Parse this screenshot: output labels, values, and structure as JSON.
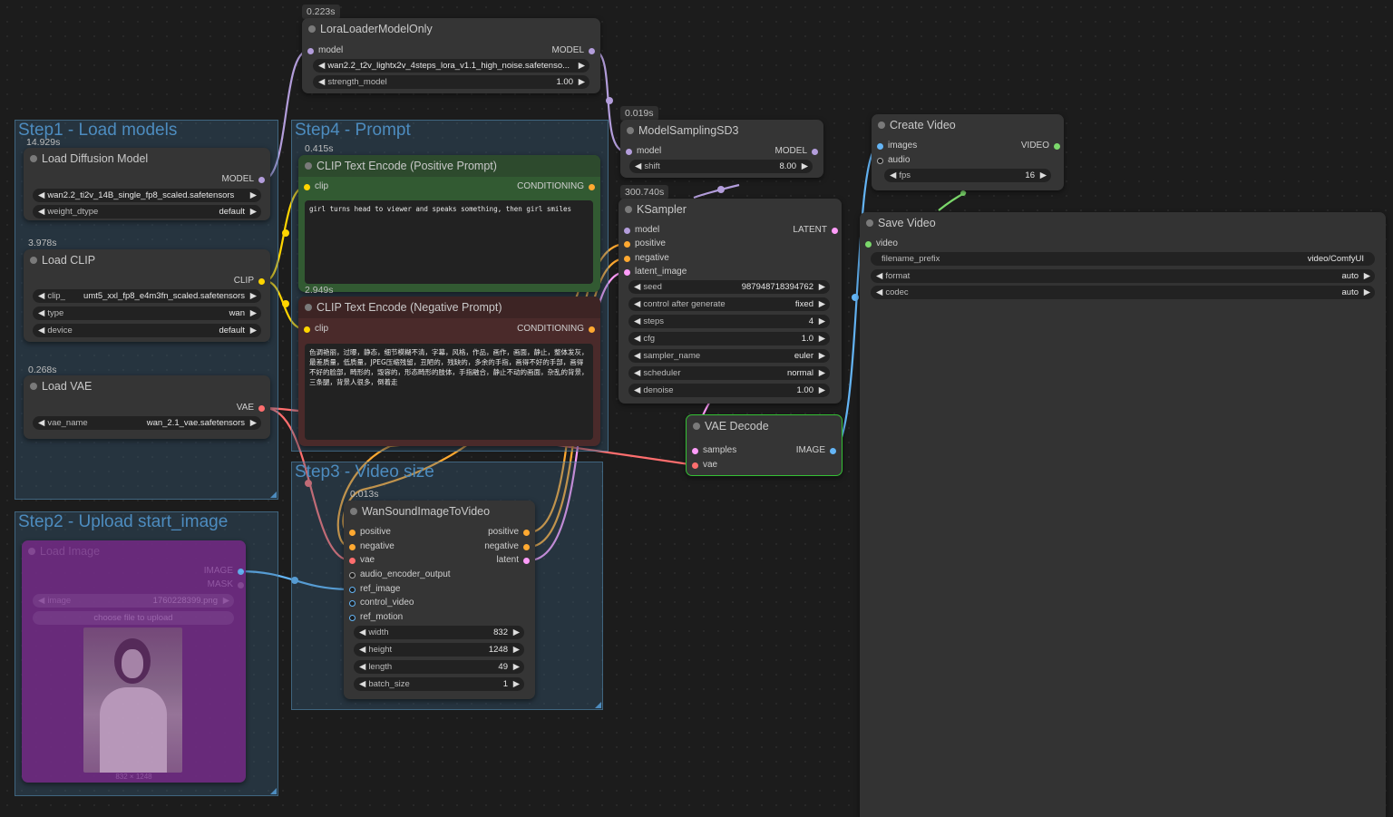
{
  "groups": {
    "step1": "Step1 - Load models",
    "step2": "Step2 - Upload start_image",
    "step3": "Step3 - Video size",
    "step4": "Step4 - Prompt"
  },
  "nodes": {
    "lora": {
      "time": "0.223s",
      "title": "LoraLoaderModelOnly",
      "in_model": "model",
      "out_model": "MODEL",
      "lora_name": "wan2.2_t2v_lightx2v_4steps_lora_v1.1_high_noise.safetenso...",
      "strength_label": "strength_model",
      "strength_value": "1.00"
    },
    "diffusion": {
      "time": "14.929s",
      "title": "Load Diffusion Model",
      "out": "MODEL",
      "unet_name": "wan2.2_ti2v_14B_single_fp8_scaled.safetensors",
      "dtype_label": "weight_dtype",
      "dtype_value": "default"
    },
    "clip": {
      "time": "3.978s",
      "title": "Load CLIP",
      "out": "CLIP",
      "clip_label": "clip_",
      "clip_value": "umt5_xxl_fp8_e4m3fn_scaled.safetensors",
      "type_label": "type",
      "type_value": "wan",
      "device_label": "device",
      "device_value": "default"
    },
    "vae": {
      "time": "0.268s",
      "title": "Load VAE",
      "out": "VAE",
      "vae_label": "vae_name",
      "vae_value": "wan_2.1_vae.safetensors"
    },
    "loadimage": {
      "title": "Load Image",
      "out_image": "IMAGE",
      "out_mask": "MASK",
      "image_label": "image",
      "image_value": "1760228399.png",
      "upload_label": "choose file to upload",
      "size_label": "832 × 1248"
    },
    "pos": {
      "time": "0.415s",
      "title": "CLIP Text Encode (Positive Prompt)",
      "in": "clip",
      "out": "CONDITIONING",
      "text": "girl turns head to viewer and speaks something, then girl smiles"
    },
    "neg": {
      "time": "2.949s",
      "title": "CLIP Text Encode (Negative Prompt)",
      "in": "clip",
      "out": "CONDITIONING",
      "text": "色调艳丽，过曝，静态，细节模糊不清，字幕，风格，作品，画作，画面，静止，整体发灰，最差质量，低质量，JPEG压缩残留，丑陋的，残缺的，多余的手指，画得不好的手部，画得不好的脸部，畸形的，毁容的，形态畸形的肢体，手指融合，静止不动的画面，杂乱的背景，三条腿，背景人很多，倒着走"
    },
    "wan": {
      "time": "0.013s",
      "title": "WanSoundImageToVideo",
      "in_positive": "positive",
      "in_negative": "negative",
      "in_vae": "vae",
      "in_audio": "audio_encoder_output",
      "in_ref": "ref_image",
      "in_control": "control_video",
      "in_motion": "ref_motion",
      "out_positive": "positive",
      "out_negative": "negative",
      "out_latent": "latent",
      "width_label": "width",
      "width_value": "832",
      "height_label": "height",
      "height_value": "1248",
      "length_label": "length",
      "length_value": "49",
      "batch_label": "batch_size",
      "batch_value": "1"
    },
    "msd3": {
      "time": "0.019s",
      "title": "ModelSamplingSD3",
      "in": "model",
      "out": "MODEL",
      "shift_label": "shift",
      "shift_value": "8.00"
    },
    "ksampler": {
      "time": "300.740s",
      "title": "KSampler",
      "in_model": "model",
      "in_positive": "positive",
      "in_negative": "negative",
      "in_latent": "latent_image",
      "out": "LATENT",
      "seed_label": "seed",
      "seed_value": "987948718394762",
      "cag_label": "control after generate",
      "cag_value": "fixed",
      "steps_label": "steps",
      "steps_value": "4",
      "cfg_label": "cfg",
      "cfg_value": "1.0",
      "sampler_label": "sampler_name",
      "sampler_value": "euler",
      "scheduler_label": "scheduler",
      "scheduler_value": "normal",
      "denoise_label": "denoise",
      "denoise_value": "1.00"
    },
    "vaedecode": {
      "title": "VAE Decode",
      "in_samples": "samples",
      "in_vae": "vae",
      "out": "IMAGE"
    },
    "createvideo": {
      "title": "Create Video",
      "in_images": "images",
      "in_audio": "audio",
      "out": "VIDEO",
      "fps_label": "fps",
      "fps_value": "16"
    },
    "savevideo": {
      "title": "Save Video",
      "in_video": "video",
      "prefix_label": "filename_prefix",
      "prefix_value": "video/ComfyUI",
      "format_label": "format",
      "format_value": "auto",
      "codec_label": "codec",
      "codec_value": "auto"
    }
  },
  "colors": {
    "model": "#b39ddb",
    "clip": "#ffd500",
    "vae": "#ff6e6e",
    "conditioning": "#ffa931",
    "latent": "#ff9cf9",
    "image": "#64b5f6",
    "video": "#7bd86b",
    "audio": "#b0b0b0",
    "group": "#4d8cbf",
    "pos_node": "#325a32",
    "neg_node": "#4a2a2a",
    "vae_decode_border": "#35c135",
    "load_image": "#7a2a8c"
  }
}
